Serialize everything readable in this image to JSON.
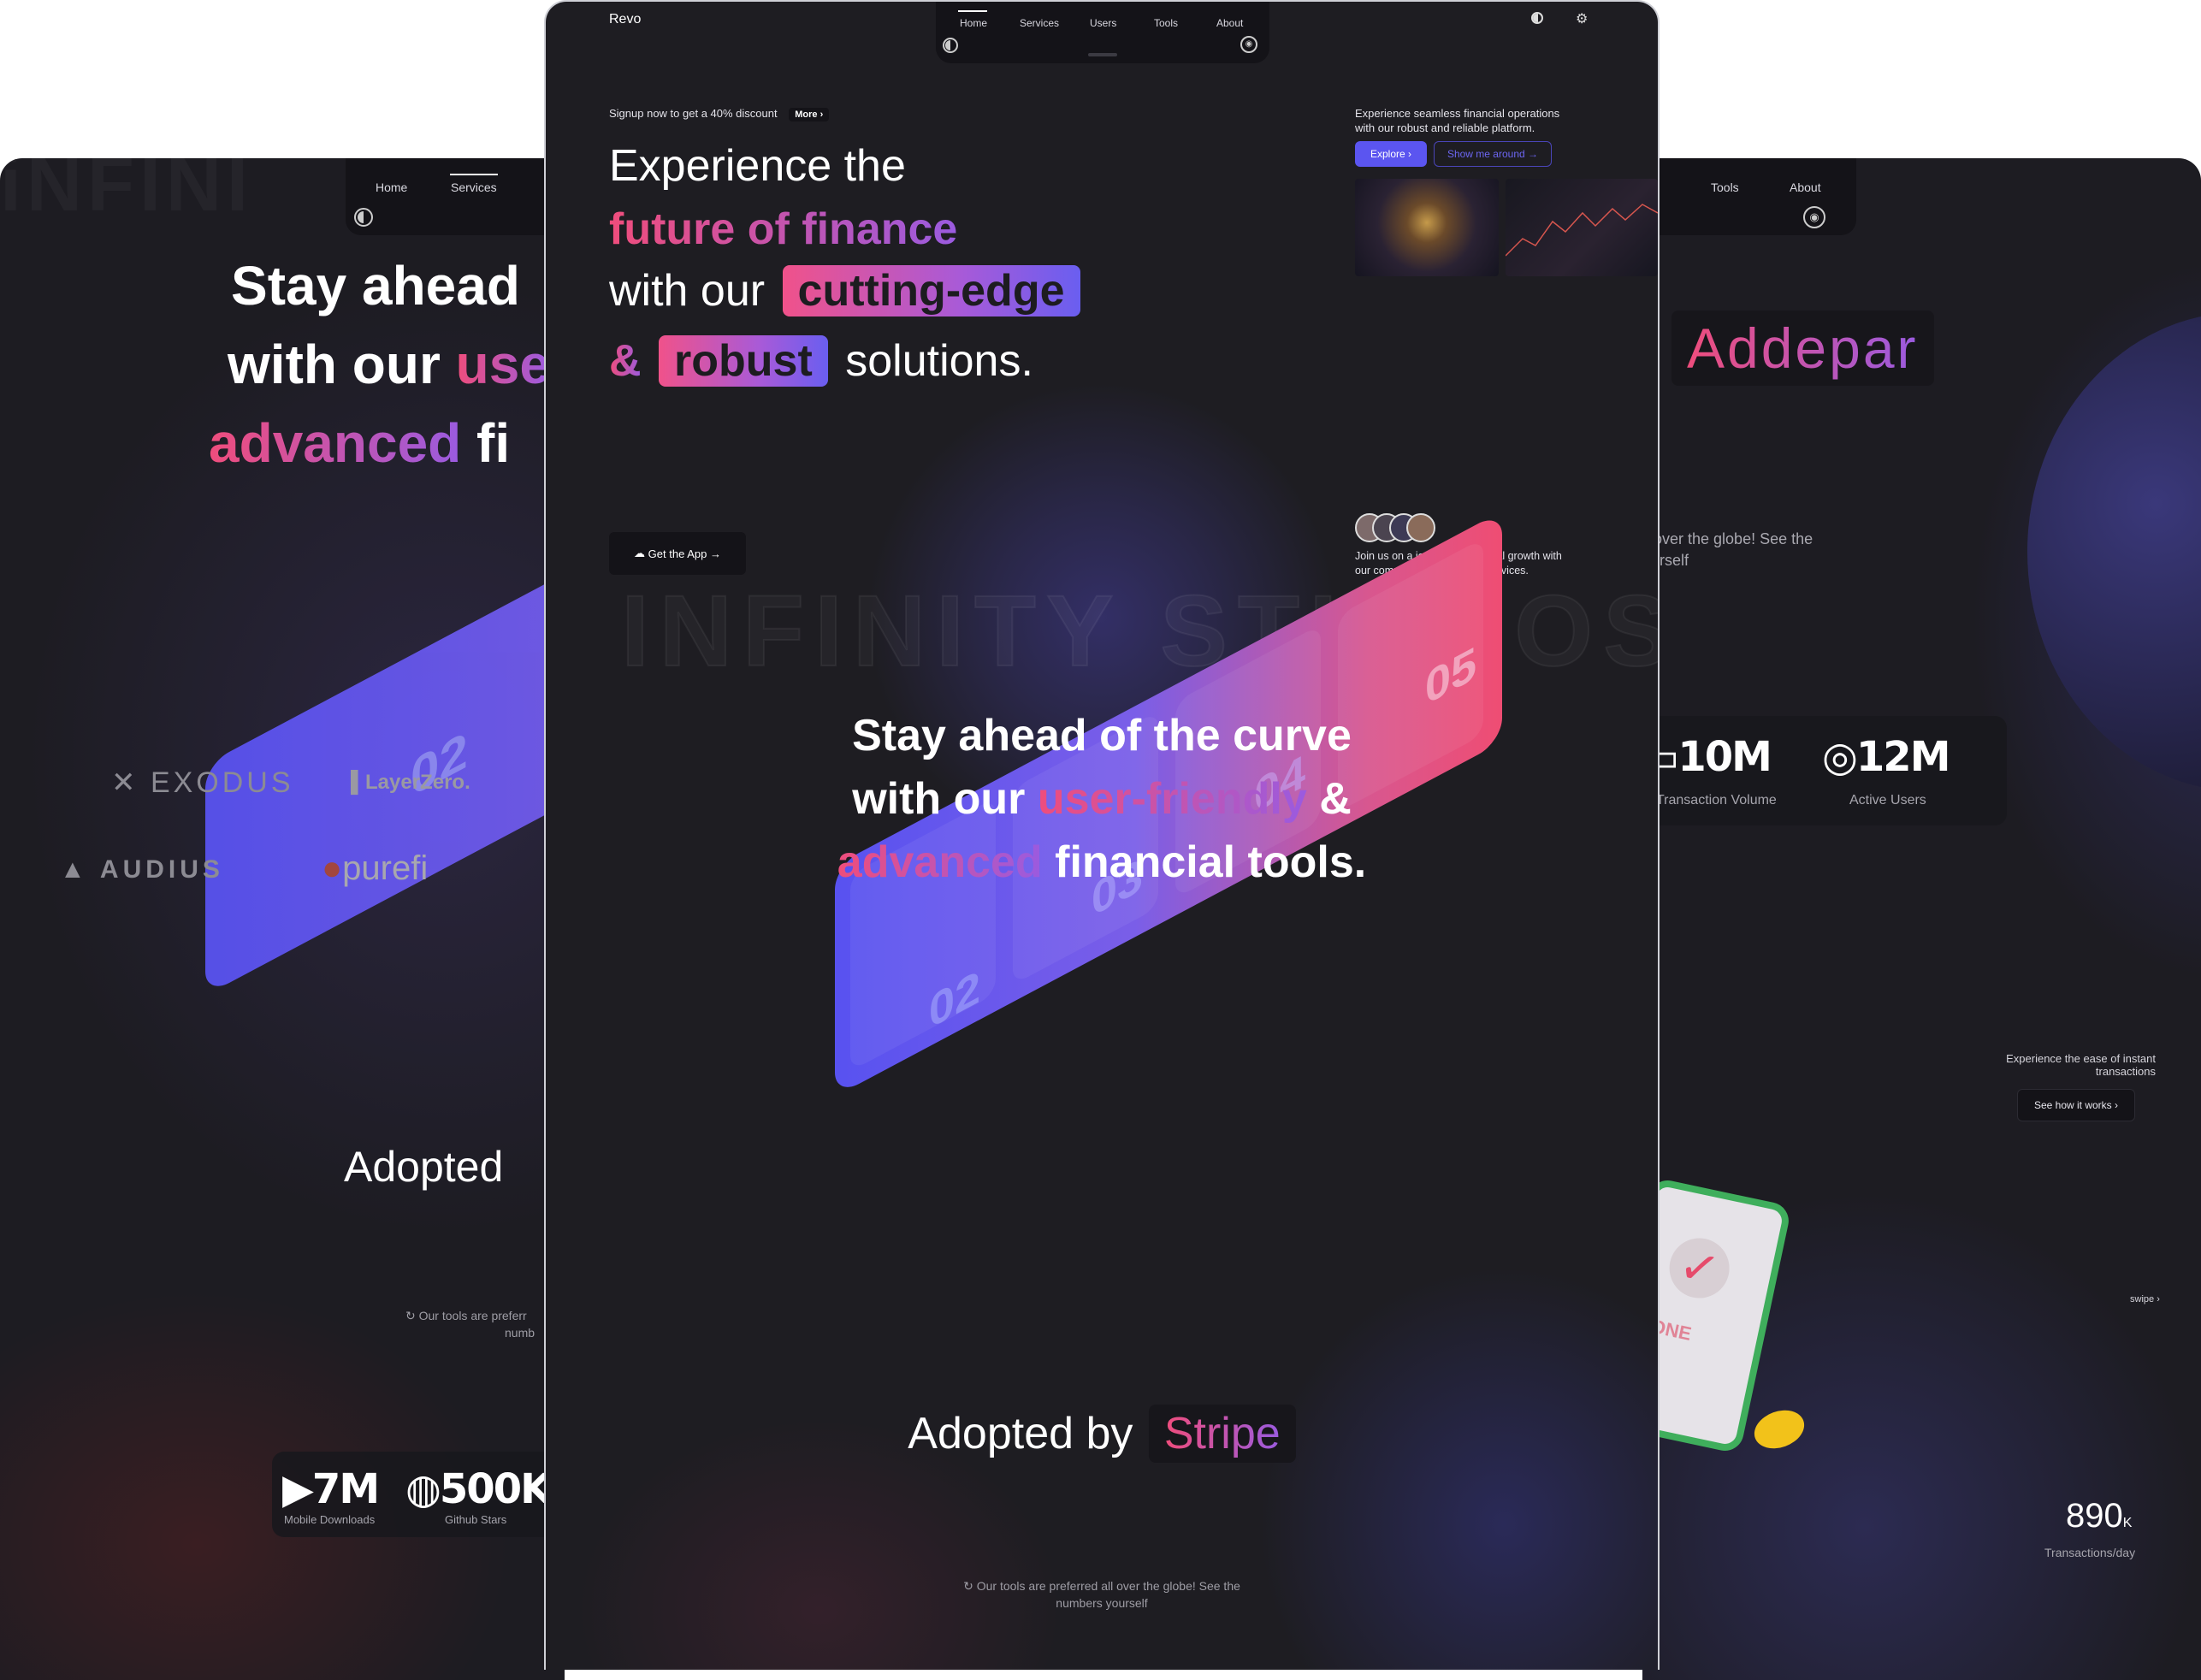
{
  "left": {
    "nav": {
      "home": "Home",
      "services": "Services"
    },
    "headline": {
      "line1": "Stay ahead",
      "line2a": "with our ",
      "line2b": "use",
      "line3a": "advanced",
      "line3b": " fi"
    },
    "plate_number": "02",
    "logos": {
      "exodus": "EXODUS",
      "layerzero": "LayerZero.",
      "audius": "AUDIUS",
      "purefi": "purefi"
    },
    "adopted": "Adopted",
    "note": {
      "line1": "Our tools are preferr",
      "line2": "numb"
    },
    "stats": [
      {
        "value": "7M",
        "label": "Mobile Downloads",
        "icon": "play-icon"
      },
      {
        "value": "500K",
        "label": "Github Stars",
        "icon": "github-icon"
      }
    ]
  },
  "center": {
    "brand": "Revo",
    "nav": [
      "Home",
      "Services",
      "Users",
      "Tools",
      "About"
    ],
    "signup": {
      "text": "Signup now to get a 40% discount",
      "more": "More"
    },
    "hero": {
      "line1": "Experience the",
      "line2": "future of finance",
      "line3a": "with our",
      "line3chip": "cutting-edge",
      "line4amp": "&",
      "line4chip": "robust",
      "line4b": "solutions."
    },
    "side": {
      "text1": "Experience seamless financial operations",
      "text2": "with our robust and reliable platform.",
      "explore": "Explore",
      "show": "Show me around"
    },
    "get_app": "Get the App",
    "join": {
      "line1": "Join us on a journey to financial growth with",
      "line2": "our comprehensive suite of services."
    },
    "watermark": "INFINITY STUDIOS",
    "headline2": {
      "line1": "Stay ahead of the curve",
      "line2a": "with our ",
      "line2b": "user-friendly",
      "line2c": " &",
      "line3a": "advanced",
      "line3b": " financial tools."
    },
    "plate_numbers": [
      "02",
      "03",
      "04",
      "05"
    ],
    "adopted": {
      "prefix": "Adopted by",
      "company": "Stripe"
    },
    "note": {
      "line1": "Our tools are preferred all over the globe! See the",
      "line2": "numbers yourself"
    }
  },
  "right": {
    "nav": {
      "tools": "Tools",
      "about": "About"
    },
    "company": "Addepar",
    "note": {
      "line1": "ll over the globe! See the",
      "line2": "ourself"
    },
    "stats": [
      {
        "value": "10M",
        "label": "Transaction Volume",
        "icon": "card-icon"
      },
      {
        "value": "12M",
        "label": "Active Users",
        "icon": "globe-icon"
      }
    ],
    "instant": {
      "line1": "Experience the ease of instant",
      "line2": "transactions",
      "button": "See how it works"
    },
    "done": "DONE",
    "swipe": "swipe",
    "tx": {
      "value": "890",
      "unit": "K",
      "label": "Transactions/day"
    }
  },
  "colors": {
    "pink": "#ef4d7c",
    "purple": "#9a5be0",
    "indigo": "#5b55f0",
    "bg": "#1e1d22"
  }
}
